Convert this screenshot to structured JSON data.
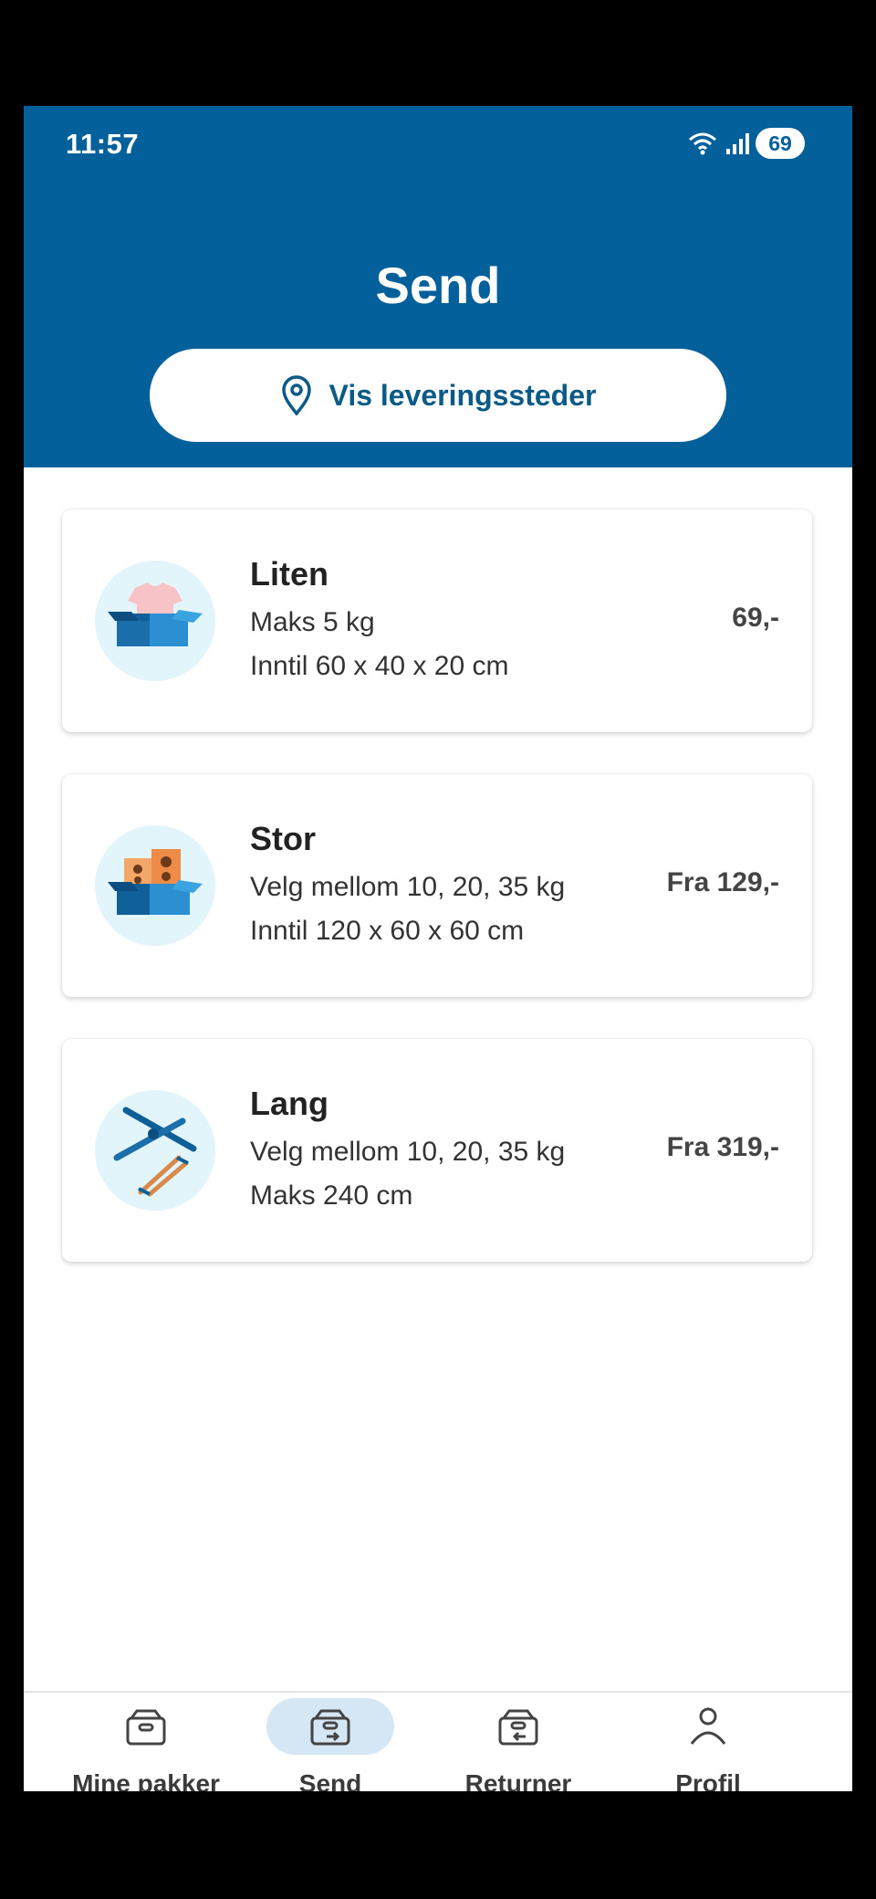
{
  "status_bar": {
    "time": "11:57",
    "battery": "69"
  },
  "header": {
    "title": "Send",
    "locations_button": "Vis leveringssteder"
  },
  "options": [
    {
      "title": "Liten",
      "line1": "Maks 5 kg",
      "line2": "Inntil 60 x 40 x 20 cm",
      "price": "69,-"
    },
    {
      "title": "Stor",
      "line1": "Velg mellom 10, 20, 35 kg",
      "line2": "Inntil 120 x 60 x 60 cm",
      "price": "Fra 129,-"
    },
    {
      "title": "Lang",
      "line1": "Velg mellom 10, 20, 35 kg",
      "line2": "Maks 240 cm",
      "price": "Fra 319,-"
    }
  ],
  "nav": [
    {
      "label": "Mine pakker",
      "icon": "package-icon"
    },
    {
      "label": "Send",
      "icon": "send-package-icon",
      "active": true
    },
    {
      "label": "Returner",
      "icon": "return-package-icon"
    },
    {
      "label": "Profil",
      "icon": "person-icon"
    }
  ],
  "colors": {
    "brand": "#04609a",
    "active_nav": "#d5e6f5"
  }
}
